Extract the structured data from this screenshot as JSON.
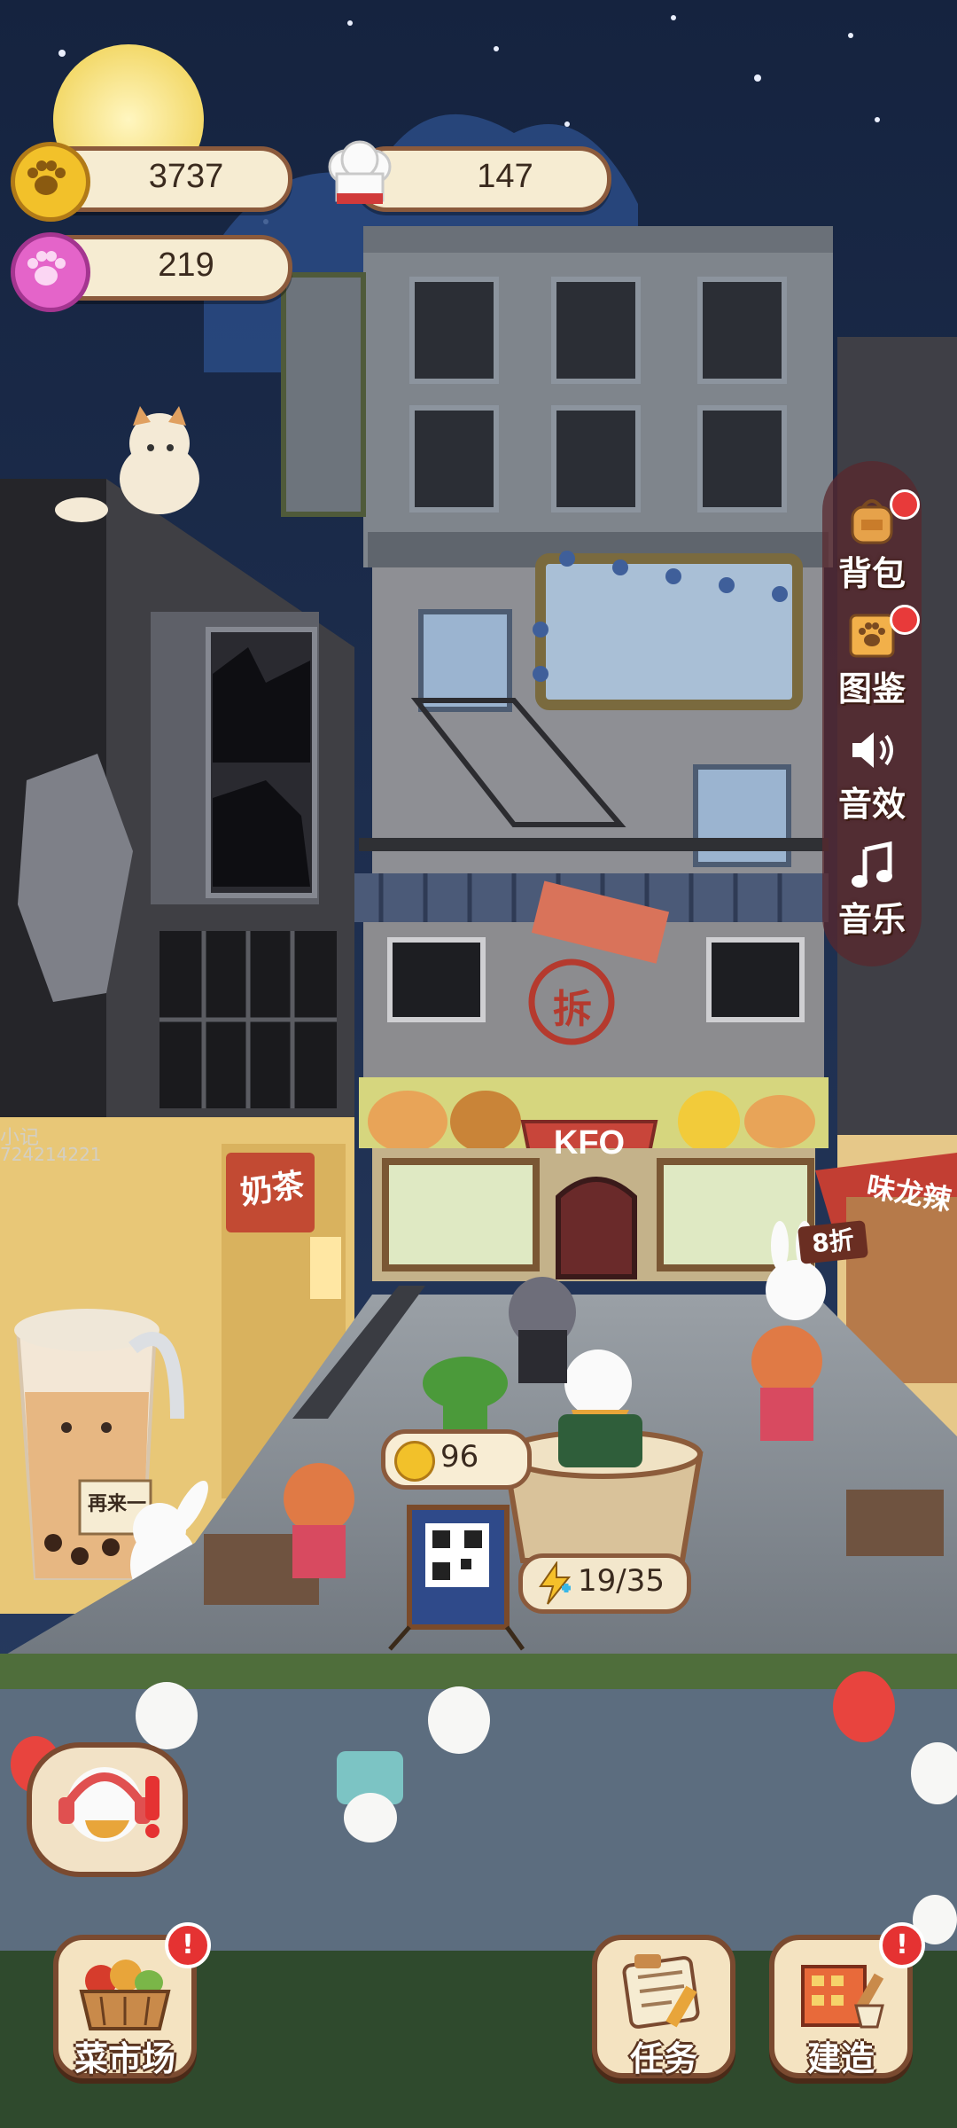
{
  "resources": {
    "paw_coins": "3737",
    "chef_hats": "147",
    "pink_paws": "219"
  },
  "side_menu": [
    {
      "label": "背包",
      "icon": "backpack-icon",
      "badge": true
    },
    {
      "label": "图鉴",
      "icon": "catalog-icon",
      "badge": true
    },
    {
      "label": "音效",
      "icon": "speaker-icon",
      "badge": false
    },
    {
      "label": "音乐",
      "icon": "music-note-icon",
      "badge": false
    }
  ],
  "shop": {
    "sign": "KFO",
    "demolish_mark": "拆",
    "milk_tea_sign": "奶茶",
    "cup_note": "再来一",
    "spicy_sign": "味龙辣",
    "discount_tag": "8折",
    "wall_text_1": "小记",
    "wall_text_2": "724214221"
  },
  "counter": {
    "coin_reward": "96",
    "energy": "19/35"
  },
  "bottom_buttons": [
    {
      "label": "菜市场",
      "icon": "vegetable-basket-icon",
      "alert": "!"
    },
    {
      "label": "任务",
      "icon": "task-scroll-icon",
      "alert": ""
    },
    {
      "label": "建造",
      "icon": "build-house-icon",
      "alert": "!"
    }
  ],
  "colors": {
    "night_sky": "#1b2a4a",
    "pill_bg": "#f6ecd2",
    "pill_border": "#8b5a3c",
    "alert_red": "#e53232",
    "kfo_red": "#c8453a"
  }
}
